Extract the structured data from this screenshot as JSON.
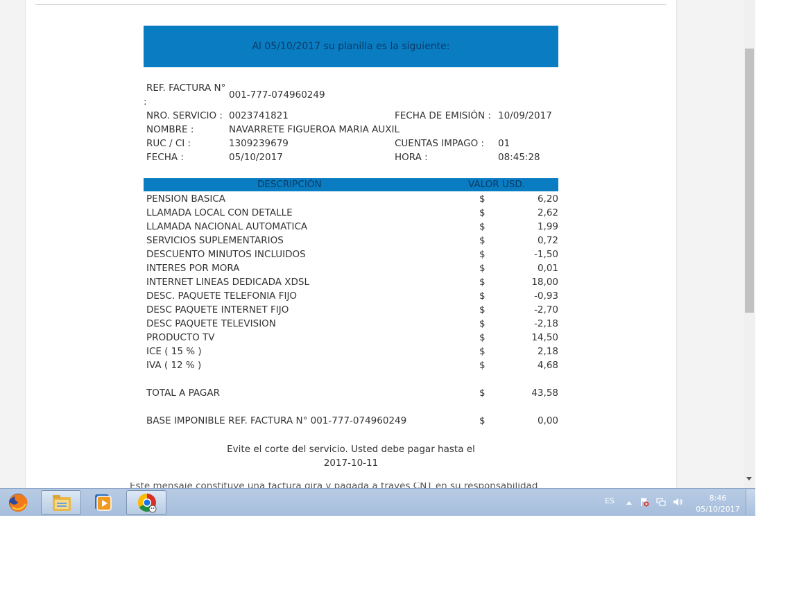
{
  "banner": "Al 05/10/2017 su planilla es la siguiente:",
  "header": {
    "ref_factura_label": "REF. FACTURA N°",
    "ref_factura_colon": ":",
    "ref_factura_value": "001-777-074960249",
    "nro_servicio_label": "NRO. SERVICIO :",
    "nro_servicio_value": "0023741821",
    "fecha_emision_label": "FECHA DE EMISIÓN :",
    "fecha_emision_value": "10/09/2017",
    "nombre_label": "NOMBRE :",
    "nombre_value": "NAVARRETE FIGUEROA MARIA AUXIL",
    "ruc_label": "RUC / CI :",
    "ruc_value": "1309239679",
    "cuentas_impago_label": "CUENTAS IMPAGO :",
    "cuentas_impago_value": "01",
    "fecha_label": "FECHA :",
    "fecha_value": "05/10/2017",
    "hora_label": "HORA :",
    "hora_value": "08:45:28"
  },
  "table": {
    "col_desc": "DESCRIPCIÓN",
    "col_value": "VALOR USD.",
    "currency": "$",
    "rows": [
      {
        "desc": "PENSION BASICA",
        "value": "6,20"
      },
      {
        "desc": "LLAMADA LOCAL CON DETALLE",
        "value": "2,62"
      },
      {
        "desc": "LLAMADA NACIONAL AUTOMATICA",
        "value": "1,99"
      },
      {
        "desc": "SERVICIOS SUPLEMENTARIOS",
        "value": "0,72"
      },
      {
        "desc": "DESCUENTO MINUTOS INCLUIDOS",
        "value": "-1,50"
      },
      {
        "desc": "INTERES POR MORA",
        "value": "0,01"
      },
      {
        "desc": "INTERNET LINEAS DEDICADA XDSL",
        "value": "18,00"
      },
      {
        "desc": "DESC. PAQUETE TELEFONIA FIJO",
        "value": "-0,93"
      },
      {
        "desc": "DESC PAQUETE INTERNET FIJO",
        "value": "-2,70"
      },
      {
        "desc": "DESC PAQUETE TELEVISION",
        "value": "-2,18"
      },
      {
        "desc": "PRODUCTO TV",
        "value": "14,50"
      },
      {
        "desc": "ICE ( 15 % )",
        "value": "2,18"
      },
      {
        "desc": "IVA ( 12 % )",
        "value": "4,68"
      }
    ],
    "total_label": "TOTAL A PAGAR",
    "total_value": "43,58",
    "base_label": "BASE IMPONIBLE REF. FACTURA N° 001-777-074960249",
    "base_value": "0,00"
  },
  "notice_line1": "Evite el corte del servicio. Usted debe pagar hasta el",
  "notice_line2": "2017-10-11",
  "cut_text": "Este mensaje constituye una factura gira y pagada a través CNT en su responsabilidad de pago",
  "taskbar": {
    "apps": [
      "firefox-icon",
      "file-explorer-icon",
      "media-player-icon",
      "chrome-icon"
    ],
    "language": "ES",
    "time": "8:46",
    "date": "05/10/2017"
  },
  "colors": {
    "accent_blue": "#0a7cc1",
    "header_text": "#0b3a66",
    "taskbar": "#a6bedc"
  }
}
